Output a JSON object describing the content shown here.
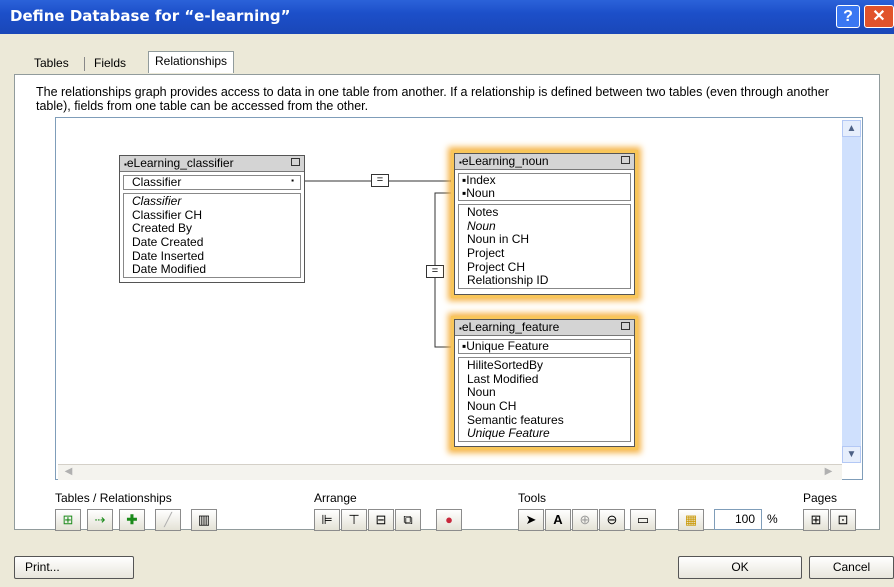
{
  "window": {
    "title": "Define Database for “e-learning”",
    "help_glyph": "?",
    "close_glyph": "✕"
  },
  "tabs": [
    {
      "label": "Tables"
    },
    {
      "label": "Fields"
    },
    {
      "label": "Relationships"
    }
  ],
  "description": "The relationships graph provides access to data in one table from another. If a relationship is defined between two tables (even through another table), fields from one table can be accessed from the other.",
  "tables": {
    "classifier": {
      "name": "eLearning_classifier",
      "keys": [
        "Classifier"
      ],
      "fields": [
        "Classifier",
        "Classifier CH",
        "Created By",
        "Date Created",
        "Date Inserted",
        "Date Modified"
      ]
    },
    "noun": {
      "name": "eLearning_noun",
      "keys": [
        "▪Index",
        "▪Noun"
      ],
      "fields": [
        "Notes",
        "Noun",
        "Noun in CH",
        "Project",
        "Project CH",
        "Relationship ID"
      ]
    },
    "feature": {
      "name": "eLearning_feature",
      "keys": [
        "▪Unique Feature"
      ],
      "fields": [
        "HiliteSortedBy",
        "Last Modified",
        "Noun",
        "Noun CH",
        "Semantic features",
        "Unique Feature"
      ]
    }
  },
  "relationship_glyph": "=",
  "toolbar": {
    "tables_relationships_label": "Tables / Relationships",
    "arrange_label": "Arrange",
    "tools_label": "Tools",
    "pages_label": "Pages",
    "zoom_value": "100",
    "zoom_unit": "%"
  },
  "buttons": {
    "print": "Print...",
    "ok": "OK",
    "cancel": "Cancel"
  }
}
